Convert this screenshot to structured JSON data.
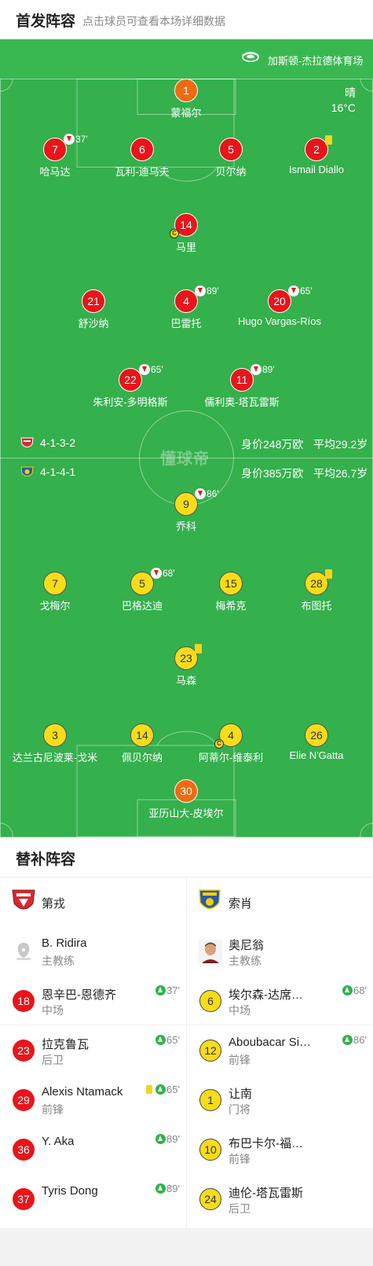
{
  "header": {
    "title": "首发阵容",
    "subtitle": "点击球员可查看本场详细数据"
  },
  "venue": {
    "name": "加斯顿-杰拉德体育场"
  },
  "weather": {
    "condition": "晴",
    "temperature": "16°C"
  },
  "watermark": "懂球帝",
  "home": {
    "formation": "4-1-3-2",
    "value": "身价248万欧",
    "avg_age": "平均29.2岁",
    "players": [
      {
        "number": "1",
        "name": "蒙福尔"
      },
      {
        "number": "7",
        "name": "哈马达",
        "sub_out": "37'"
      },
      {
        "number": "6",
        "name": "瓦利-迪乌夫"
      },
      {
        "number": "5",
        "name": "贝尔纳"
      },
      {
        "number": "2",
        "name": "Ismail Diallo",
        "yellow": true
      },
      {
        "number": "14",
        "name": "马里",
        "captain": true
      },
      {
        "number": "21",
        "name": "舒沙纳"
      },
      {
        "number": "4",
        "name": "巴雷托",
        "sub_out": "89'"
      },
      {
        "number": "20",
        "name": "Hugo Vargas-Ríos",
        "sub_out": "65'"
      },
      {
        "number": "22",
        "name": "朱利安-多明格斯",
        "sub_out": "65'"
      },
      {
        "number": "11",
        "name": "儒利奥-塔瓦雷斯",
        "sub_out": "89'"
      }
    ]
  },
  "away": {
    "formation": "4-1-4-1",
    "value": "身价385万欧",
    "avg_age": "平均26.7岁",
    "players": [
      {
        "number": "9",
        "name": "乔科",
        "sub_out": "86'"
      },
      {
        "number": "7",
        "name": "戈梅尔"
      },
      {
        "number": "5",
        "name": "巴格达迪",
        "sub_out": "68'"
      },
      {
        "number": "15",
        "name": "梅希克"
      },
      {
        "number": "28",
        "name": "布图托",
        "yellow": true
      },
      {
        "number": "23",
        "name": "马森",
        "yellow": true
      },
      {
        "number": "3",
        "name": "达兰古尼波莱-戈米"
      },
      {
        "number": "14",
        "name": "佩贝尔纳"
      },
      {
        "number": "4",
        "name": "阿蒂尔-维泰利",
        "captain": true
      },
      {
        "number": "26",
        "name": "Elie N'Gatta"
      },
      {
        "number": "30",
        "name": "亚历山大-皮埃尔"
      }
    ]
  },
  "subs": {
    "title": "替补阵容",
    "home": {
      "team_name": "第戎",
      "coach": {
        "name": "B. Ridira",
        "role": "主教练"
      },
      "players": [
        {
          "number": "18",
          "name": "恩辛巴-恩德齐",
          "position": "中场",
          "sub_in": "37'"
        },
        {
          "number": "23",
          "name": "拉克鲁瓦",
          "position": "后卫",
          "sub_in": "65'"
        },
        {
          "number": "29",
          "name": "Alexis Ntamack",
          "position": "前锋",
          "sub_in": "65'",
          "yellow": true
        },
        {
          "number": "36",
          "name": "Y. Aka",
          "position": "",
          "sub_in": "89'"
        },
        {
          "number": "37",
          "name": "Tyris Dong",
          "position": "",
          "sub_in": "89'"
        }
      ]
    },
    "away": {
      "team_name": "索肖",
      "coach": {
        "name": "奥尼翁",
        "role": "主教练"
      },
      "players": [
        {
          "number": "6",
          "name": "埃尔森-达席…",
          "position": "中场",
          "sub_in": "68'"
        },
        {
          "number": "12",
          "name": "Aboubacar Si…",
          "position": "前锋",
          "sub_in": "86'"
        },
        {
          "number": "1",
          "name": "让南",
          "position": "门将"
        },
        {
          "number": "10",
          "name": "布巴卡尔-福…",
          "position": "前锋"
        },
        {
          "number": "24",
          "name": "迪伦-塔瓦雷斯",
          "position": "后卫"
        }
      ]
    }
  },
  "colors": {
    "pitch": "#34b04c",
    "home_jersey": "#e8151b",
    "away_jersey": "#f8dc1a",
    "goalkeeper_home": "#ee6a13",
    "sub_in": "#2fb34a"
  }
}
